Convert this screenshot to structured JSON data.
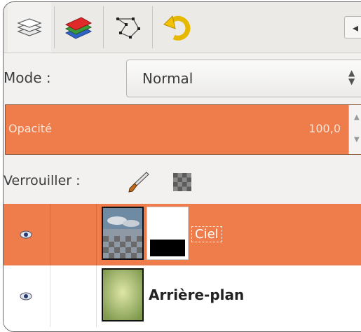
{
  "tabs": [
    {
      "icon": "layers-icon"
    },
    {
      "icon": "channels-icon"
    },
    {
      "icon": "paths-icon"
    },
    {
      "icon": "undo-history-icon"
    }
  ],
  "tab_menu_icon": "tab-menu-icon",
  "mode": {
    "label": "Mode :",
    "value": "Normal"
  },
  "opacity": {
    "label": "Opacité",
    "value": "100,0",
    "fill_percent": 100
  },
  "lock": {
    "label": "Verrouiller :",
    "icons": [
      "lock-pixels-brush-icon",
      "lock-alpha-icon"
    ]
  },
  "layers": [
    {
      "name": "Ciel",
      "visible": true,
      "selected": true,
      "has_mask": true
    },
    {
      "name": "Arrière-plan",
      "visible": true,
      "selected": false,
      "has_mask": false
    }
  ],
  "colors": {
    "accent": "#ee7d4b",
    "panel": "#f2f1f0"
  }
}
